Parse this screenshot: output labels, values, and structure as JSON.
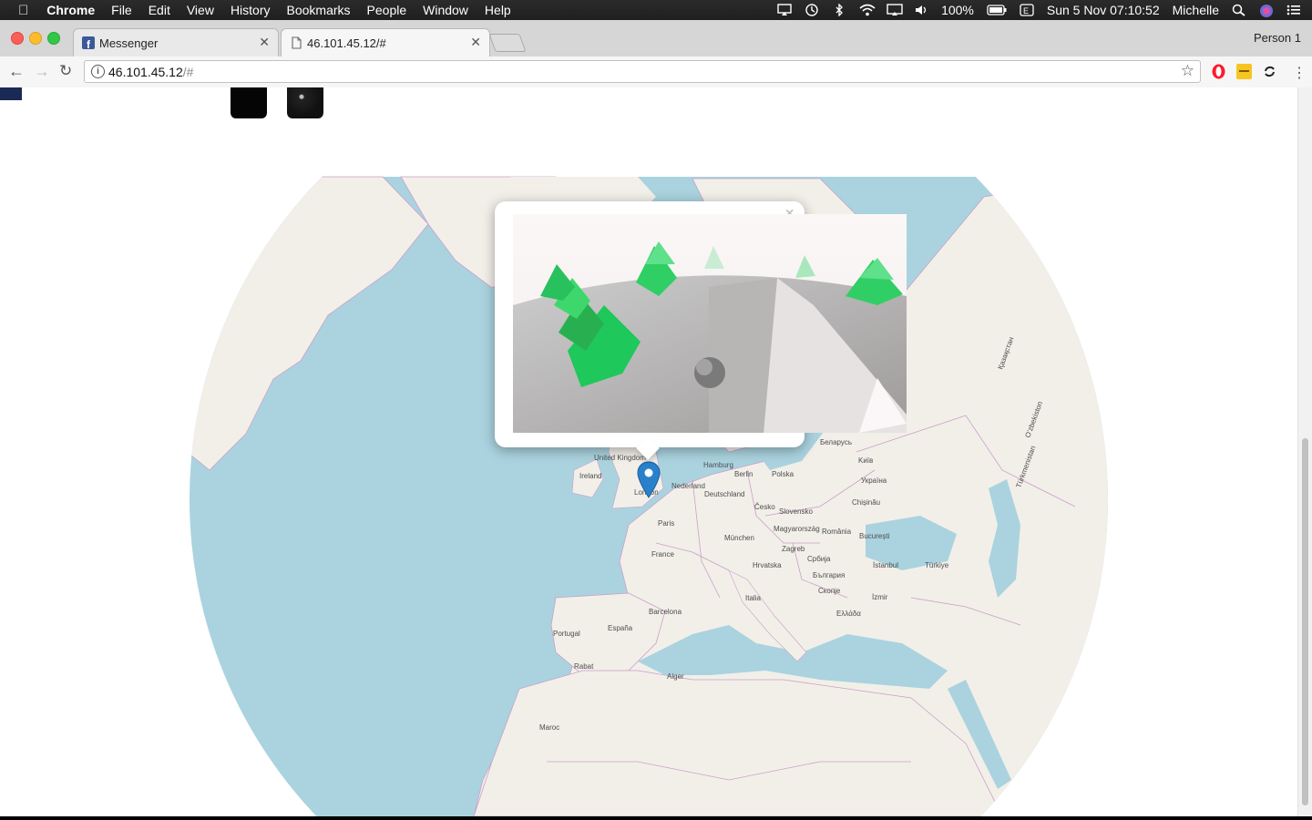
{
  "menubar": {
    "apple": "",
    "app_name": "Chrome",
    "items": [
      "File",
      "Edit",
      "View",
      "History",
      "Bookmarks",
      "People",
      "Window",
      "Help"
    ],
    "battery": "100%",
    "clock": "Sun 5 Nov  07:10:52",
    "user": "Michelle"
  },
  "tabs": [
    {
      "title": "Messenger",
      "icon": "facebook-icon"
    },
    {
      "title": "46.101.45.12/#",
      "icon": "document-icon"
    }
  ],
  "profile": "Person 1",
  "toolbar": {
    "url_host": "46.101.45.12",
    "url_rest": "/#"
  },
  "popup": {
    "close": "×"
  },
  "map": {
    "labels": [
      "United Kingdom",
      "Ireland",
      "London",
      "Paris",
      "France",
      "Nederland",
      "Hamburg",
      "Berlin",
      "Deutschland",
      "Polska",
      "Česko",
      "München",
      "Slovensko",
      "Magyarország",
      "Zagreb",
      "Hrvatska",
      "România",
      "București",
      "Србија",
      "България",
      "Italia",
      "Barcelona",
      "España",
      "Portugal",
      "Rabat",
      "Alger",
      "Maroc",
      "Беларусь",
      "Україна",
      "Chișinău",
      "Kиїв",
      "İstanbul",
      "Türkiye",
      "İzmir",
      "Ελλάδα",
      "Скопје",
      "Қазақстан",
      "Oʻzbekiston",
      "Türkmenistan"
    ]
  },
  "colors": {
    "water": "#aad3df",
    "land": "#f2efe9",
    "border": "#c9a0c9",
    "marker": "#2a81cb",
    "tree": "#1ec85a"
  }
}
